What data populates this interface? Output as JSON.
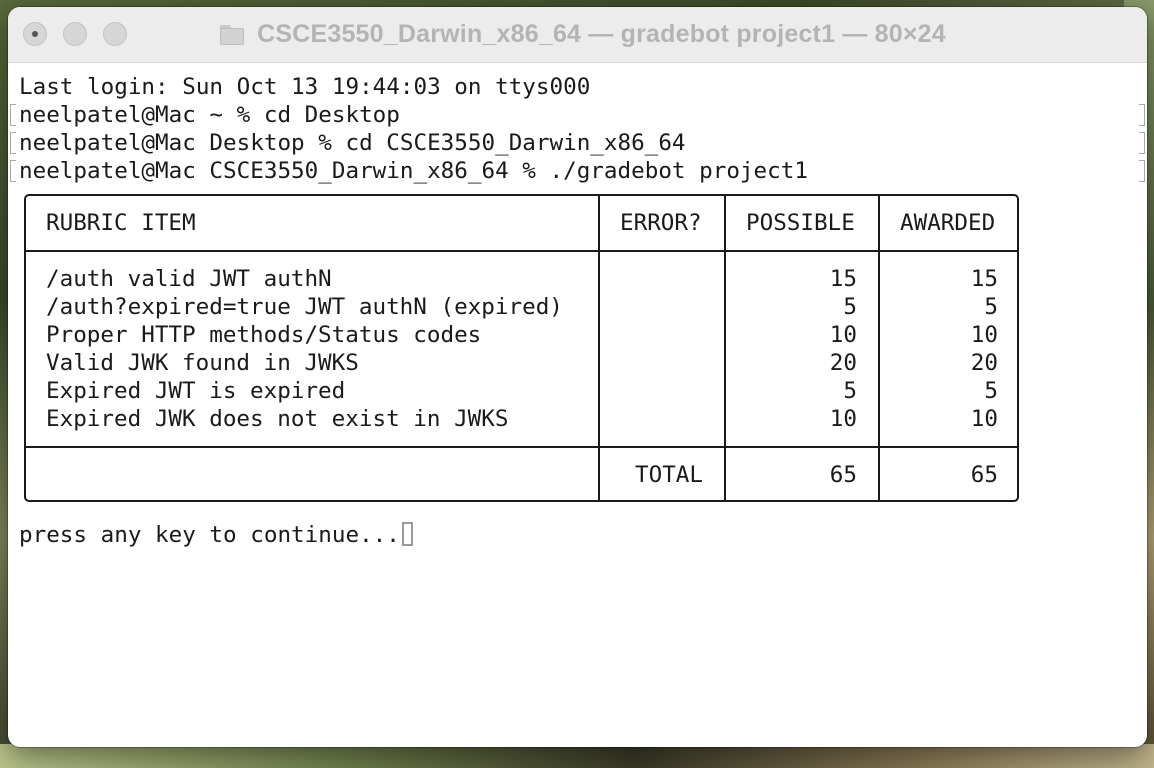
{
  "window": {
    "title": "CSCE3550_Darwin_x86_64 — gradebot project1 — 80×24",
    "title_icon": "folder-icon"
  },
  "terminal": {
    "lines": [
      "Last login: Sun Oct 13 19:44:03 on ttys000",
      "neelpatel@Mac ~ % cd Desktop",
      "neelpatel@Mac Desktop % cd CSCE3550_Darwin_x86_64",
      "neelpatel@Mac CSCE3550_Darwin_x86_64 % ./gradebot project1"
    ],
    "rubric": {
      "headers": [
        "RUBRIC ITEM",
        "ERROR?",
        "POSSIBLE",
        "AWARDED"
      ],
      "rows": [
        {
          "item": "/auth valid JWT authN",
          "error": "",
          "possible": "15",
          "awarded": "15"
        },
        {
          "item": "/auth?expired=true JWT authN (expired)",
          "error": "",
          "possible": "5",
          "awarded": "5"
        },
        {
          "item": "Proper HTTP methods/Status codes",
          "error": "",
          "possible": "10",
          "awarded": "10"
        },
        {
          "item": "Valid JWK found in JWKS",
          "error": "",
          "possible": "20",
          "awarded": "20"
        },
        {
          "item": "Expired JWT is expired",
          "error": "",
          "possible": "5",
          "awarded": "5"
        },
        {
          "item": "Expired JWK does not exist in JWKS",
          "error": "",
          "possible": "10",
          "awarded": "10"
        }
      ],
      "total": {
        "label": "TOTAL",
        "possible": "65",
        "awarded": "65"
      }
    },
    "prompt_text": "press any key to continue..."
  }
}
